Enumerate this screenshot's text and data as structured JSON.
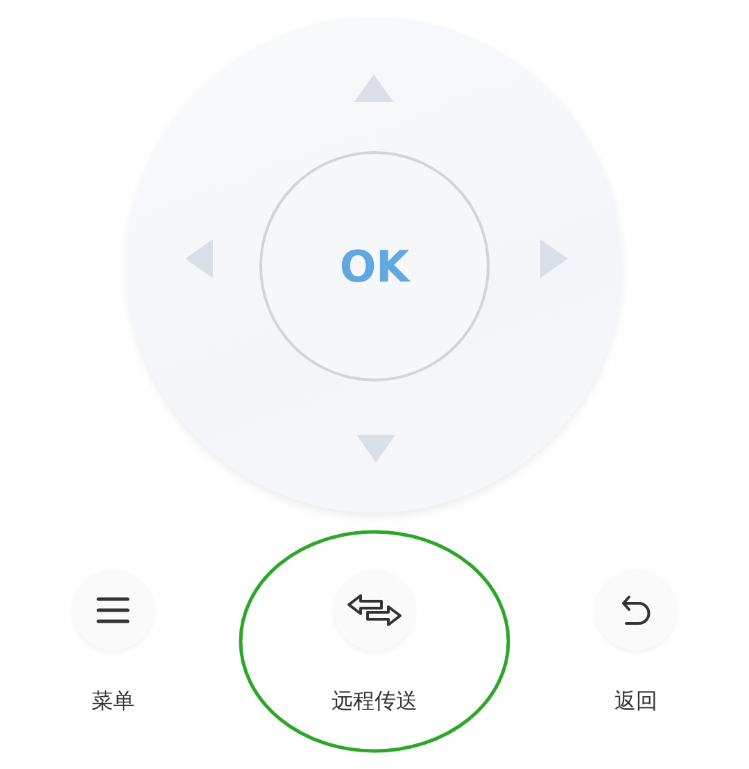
{
  "dpad": {
    "center_label": "OK"
  },
  "buttons": [
    {
      "kind": "menu",
      "label": "菜单",
      "highlighted": false
    },
    {
      "kind": "transfer",
      "label": "远程传送",
      "highlighted": true
    },
    {
      "kind": "back",
      "label": "返回",
      "highlighted": false
    }
  ]
}
